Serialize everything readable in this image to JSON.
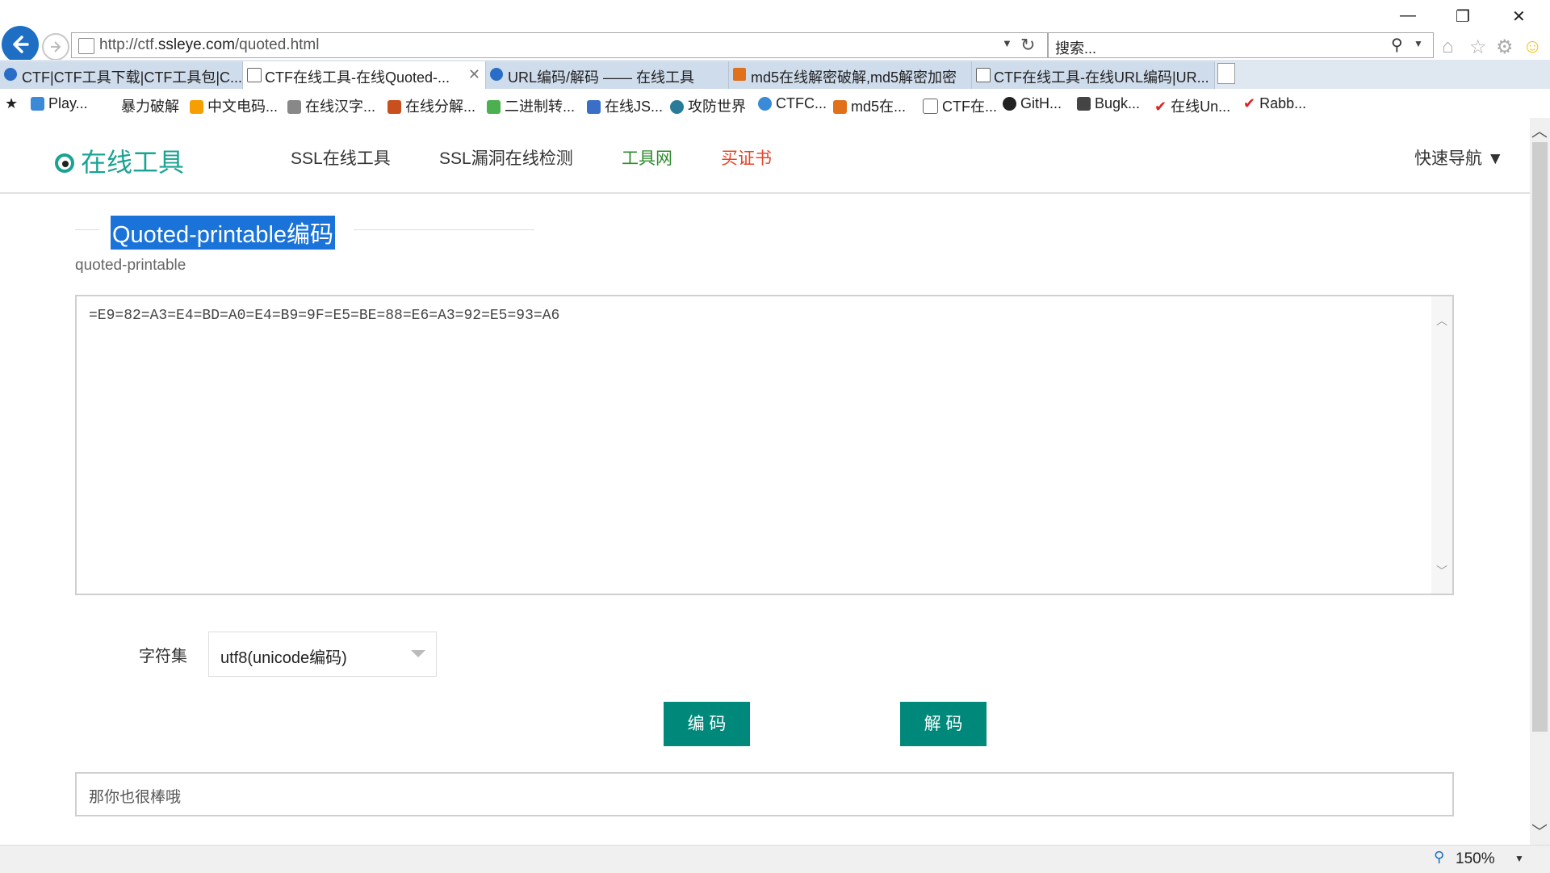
{
  "browser": {
    "url_prefix": "http://ctf.",
    "url_domain": "ssleye.com",
    "url_path": "/quoted.html",
    "search_placeholder": "搜索...",
    "tabs": [
      {
        "label": "CTF|CTF工具下载|CTF工具包|C...",
        "active": false
      },
      {
        "label": "CTF在线工具-在线Quoted-...",
        "active": true
      },
      {
        "label": "URL编码/解码 —— 在线工具",
        "active": false
      },
      {
        "label": "md5在线解密破解,md5解密加密",
        "active": false
      },
      {
        "label": "CTF在线工具-在线URL编码|UR...",
        "active": false
      }
    ],
    "favorites": [
      "Play...",
      "暴力破解",
      "中文电码...",
      "在线汉字...",
      "在线分解...",
      "二进制转...",
      "在线JS...",
      "攻防世界",
      "CTFC...",
      "md5在...",
      "CTF在...",
      "GitH...",
      "Bugk...",
      "在线Un...",
      "Rabb..."
    ],
    "zoom": "150%"
  },
  "site": {
    "logo_text": "在线工具",
    "nav": [
      "SSL在线工具",
      "SSL漏洞在线检测",
      "工具网",
      "买证书"
    ],
    "quick_nav": "快速导航"
  },
  "tool": {
    "title": "Quoted-printable编码",
    "subtitle": "quoted-printable",
    "input_value": "=E9=82=A3=E4=BD=A0=E4=B9=9F=E5=BE=88=E6=A3=92=E5=93=A6",
    "charset_label": "字符集",
    "charset_value": "utf8(unicode编码)",
    "encode_label": "编 码",
    "decode_label": "解 码",
    "output_value": "那你也很棒哦"
  },
  "colors": {
    "accent": "#00897b",
    "logo": "#1aa393",
    "nav_green": "#2e8b2e",
    "nav_red": "#e8442a",
    "selection": "#1a73d9"
  }
}
